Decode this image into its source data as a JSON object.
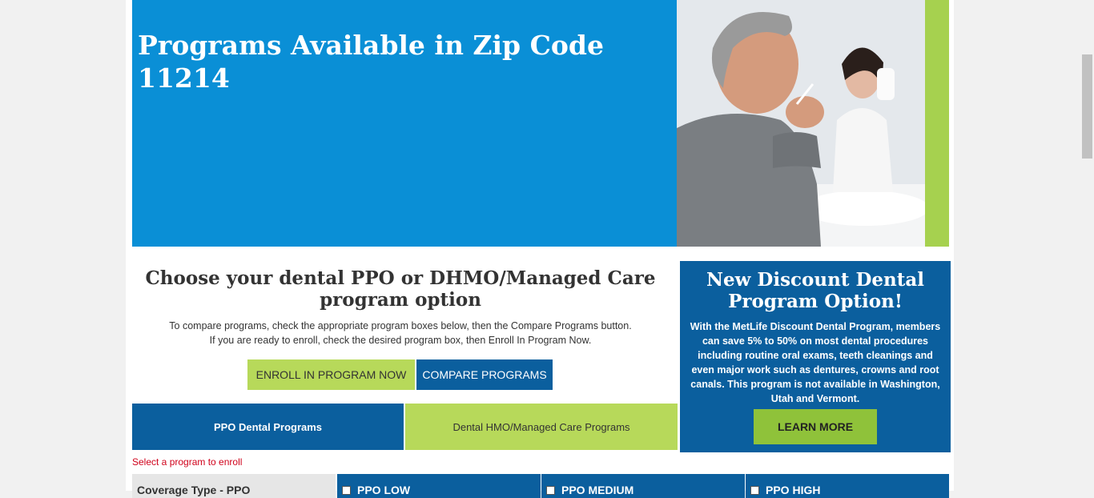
{
  "hero": {
    "title": "Programs Available in Zip Code 11214",
    "photo_icon": "couple-brushing-teeth-photo"
  },
  "choose": {
    "heading": "Choose your dental PPO or DHMO/Managed Care program option",
    "instructions_line1": "To compare programs, check the appropriate program boxes below, then the Compare Programs button.",
    "instructions_line2": "If you are ready to enroll, check the desired program box, then Enroll In Program Now."
  },
  "buttons": {
    "enroll": "ENROLL IN PROGRAM NOW",
    "compare": "COMPARE PROGRAMS"
  },
  "tabs": [
    {
      "label": "PPO Dental Programs"
    },
    {
      "label": "Dental HMO/Managed Care Programs"
    }
  ],
  "select_message": "Select a program to enroll",
  "table": {
    "coverage_type": "Coverage Type - PPO",
    "plans": [
      "PPO LOW",
      "PPO MEDIUM",
      "PPO HIGH"
    ]
  },
  "promo": {
    "title": "New Discount Dental Program Option!",
    "body": "With the MetLife Discount Dental Program, members can save 5% to 50% on most dental procedures including routine oral exams, teeth cleanings and even major work such as dentures, crowns and root canals. This program is not available in Washington, Utah and Vermont.",
    "button": "LEARN MORE"
  },
  "colors": {
    "hero_blue": "#0a8fd6",
    "navy": "#0b5f9e",
    "green": "#b7d95a",
    "error": "#d0021b"
  }
}
